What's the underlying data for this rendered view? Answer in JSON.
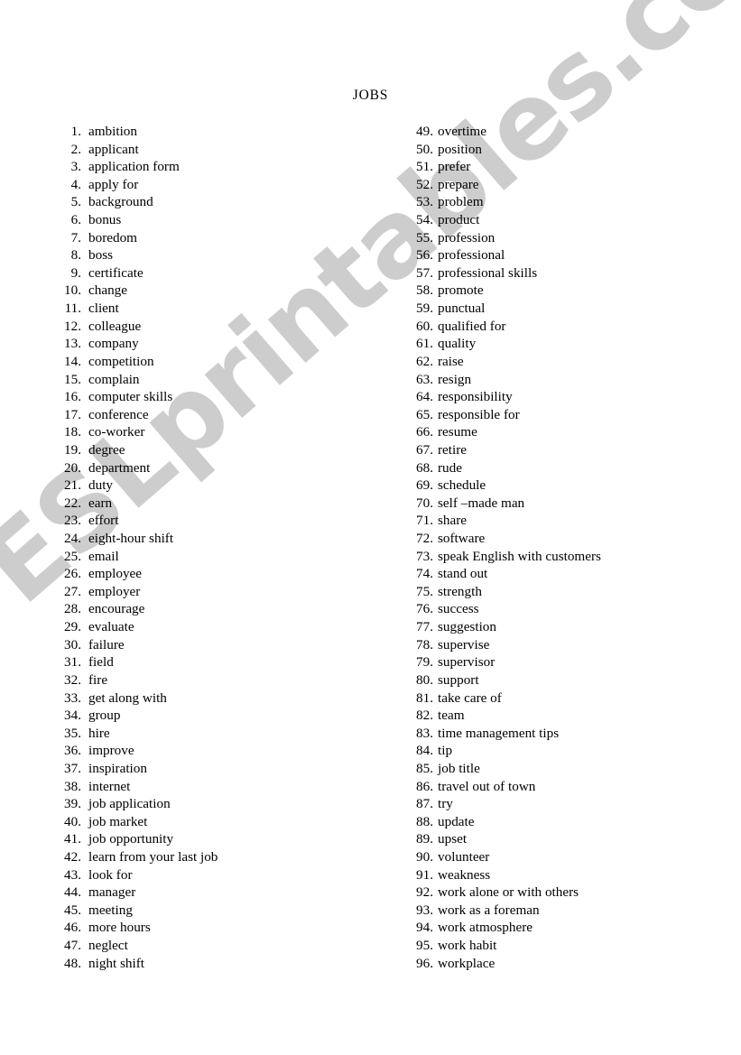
{
  "document": {
    "title": "JOBS",
    "watermark": "ESLprintables.com",
    "watermark_color": "#cdcdcd",
    "text_color": "#000000",
    "background_color": "#ffffff"
  },
  "columns": {
    "left": {
      "items": [
        {
          "number": "1.",
          "label": "ambition"
        },
        {
          "number": "2.",
          "label": "applicant"
        },
        {
          "number": "3.",
          "label": "application form"
        },
        {
          "number": "4.",
          "label": "apply for"
        },
        {
          "number": "5.",
          "label": "background"
        },
        {
          "number": "6.",
          "label": "bonus"
        },
        {
          "number": "7.",
          "label": "boredom"
        },
        {
          "number": "8.",
          "label": "boss"
        },
        {
          "number": "9.",
          "label": "certificate"
        },
        {
          "number": "10.",
          "label": "change"
        },
        {
          "number": "11.",
          "label": "client"
        },
        {
          "number": "12.",
          "label": "colleague"
        },
        {
          "number": "13.",
          "label": "company"
        },
        {
          "number": "14.",
          "label": "competition"
        },
        {
          "number": "15.",
          "label": "complain"
        },
        {
          "number": "16.",
          "label": "computer skills"
        },
        {
          "number": "17.",
          "label": "conference"
        },
        {
          "number": "18.",
          "label": "co-worker"
        },
        {
          "number": "19.",
          "label": "degree"
        },
        {
          "number": "20.",
          "label": "department"
        },
        {
          "number": "21.",
          "label": "duty"
        },
        {
          "number": "22.",
          "label": "earn"
        },
        {
          "number": "23.",
          "label": "effort"
        },
        {
          "number": "24.",
          "label": "eight-hour shift"
        },
        {
          "number": "25.",
          "label": "email"
        },
        {
          "number": "26.",
          "label": "employee"
        },
        {
          "number": "27.",
          "label": "employer"
        },
        {
          "number": "28.",
          "label": "encourage"
        },
        {
          "number": "29.",
          "label": "evaluate"
        },
        {
          "number": "30.",
          "label": "failure"
        },
        {
          "number": "31.",
          "label": "field"
        },
        {
          "number": "32.",
          "label": "fire"
        },
        {
          "number": "33.",
          "label": "get along with"
        },
        {
          "number": "34.",
          "label": "group"
        },
        {
          "number": "35.",
          "label": "hire"
        },
        {
          "number": "36.",
          "label": "improve"
        },
        {
          "number": "37.",
          "label": "inspiration"
        },
        {
          "number": "38.",
          "label": "internet"
        },
        {
          "number": "39.",
          "label": "job application"
        },
        {
          "number": "40.",
          "label": "job market"
        },
        {
          "number": "41.",
          "label": "job opportunity"
        },
        {
          "number": "42.",
          "label": "learn from your last job"
        },
        {
          "number": "43.",
          "label": "look for"
        },
        {
          "number": "44.",
          "label": "manager"
        },
        {
          "number": "45.",
          "label": "meeting"
        },
        {
          "number": "46.",
          "label": "more hours"
        },
        {
          "number": "47.",
          "label": "neglect"
        },
        {
          "number": "48.",
          "label": "night shift"
        }
      ]
    },
    "right": {
      "items": [
        {
          "number": "49.",
          "label": "overtime"
        },
        {
          "number": "50.",
          "label": "position"
        },
        {
          "number": "51.",
          "label": "prefer"
        },
        {
          "number": "52.",
          "label": "prepare"
        },
        {
          "number": "53.",
          "label": "problem"
        },
        {
          "number": "54.",
          "label": "product"
        },
        {
          "number": "55.",
          "label": "profession"
        },
        {
          "number": "56.",
          "label": "professional"
        },
        {
          "number": "57.",
          "label": "professional skills"
        },
        {
          "number": "58.",
          "label": "promote"
        },
        {
          "number": "59.",
          "label": "punctual"
        },
        {
          "number": "60.",
          "label": "qualified for"
        },
        {
          "number": "61.",
          "label": "quality"
        },
        {
          "number": "62.",
          "label": "raise"
        },
        {
          "number": "63.",
          "label": "resign"
        },
        {
          "number": "64.",
          "label": "responsibility"
        },
        {
          "number": "65.",
          "label": "responsible for"
        },
        {
          "number": "66.",
          "label": "resume"
        },
        {
          "number": "67.",
          "label": "retire"
        },
        {
          "number": "68.",
          "label": "rude"
        },
        {
          "number": "69.",
          "label": "schedule"
        },
        {
          "number": "70.",
          "label": "self –made man"
        },
        {
          "number": "71.",
          "label": "share"
        },
        {
          "number": "72.",
          "label": "software"
        },
        {
          "number": "73.",
          "label": "speak English with customers"
        },
        {
          "number": "74.",
          "label": "stand out"
        },
        {
          "number": "75.",
          "label": "strength"
        },
        {
          "number": "76.",
          "label": "success"
        },
        {
          "number": "77.",
          "label": "suggestion"
        },
        {
          "number": "78.",
          "label": "supervise"
        },
        {
          "number": "79.",
          "label": "supervisor"
        },
        {
          "number": "80.",
          "label": "support"
        },
        {
          "number": "81.",
          "label": "take care of"
        },
        {
          "number": "82.",
          "label": "team"
        },
        {
          "number": "83.",
          "label": "time management tips"
        },
        {
          "number": "84.",
          "label": "tip"
        },
        {
          "number": "85.",
          "label": "job title"
        },
        {
          "number": "86.",
          "label": "travel out of town"
        },
        {
          "number": "87.",
          "label": "try"
        },
        {
          "number": "88.",
          "label": "update"
        },
        {
          "number": "89.",
          "label": "upset"
        },
        {
          "number": "90.",
          "label": "volunteer"
        },
        {
          "number": "91.",
          "label": "weakness"
        },
        {
          "number": "92.",
          "label": "work alone or with others"
        },
        {
          "number": "93.",
          "label": "work as a foreman"
        },
        {
          "number": "94.",
          "label": "work atmosphere"
        },
        {
          "number": "95.",
          "label": "work habit"
        },
        {
          "number": "96.",
          "label": "workplace"
        }
      ]
    }
  }
}
